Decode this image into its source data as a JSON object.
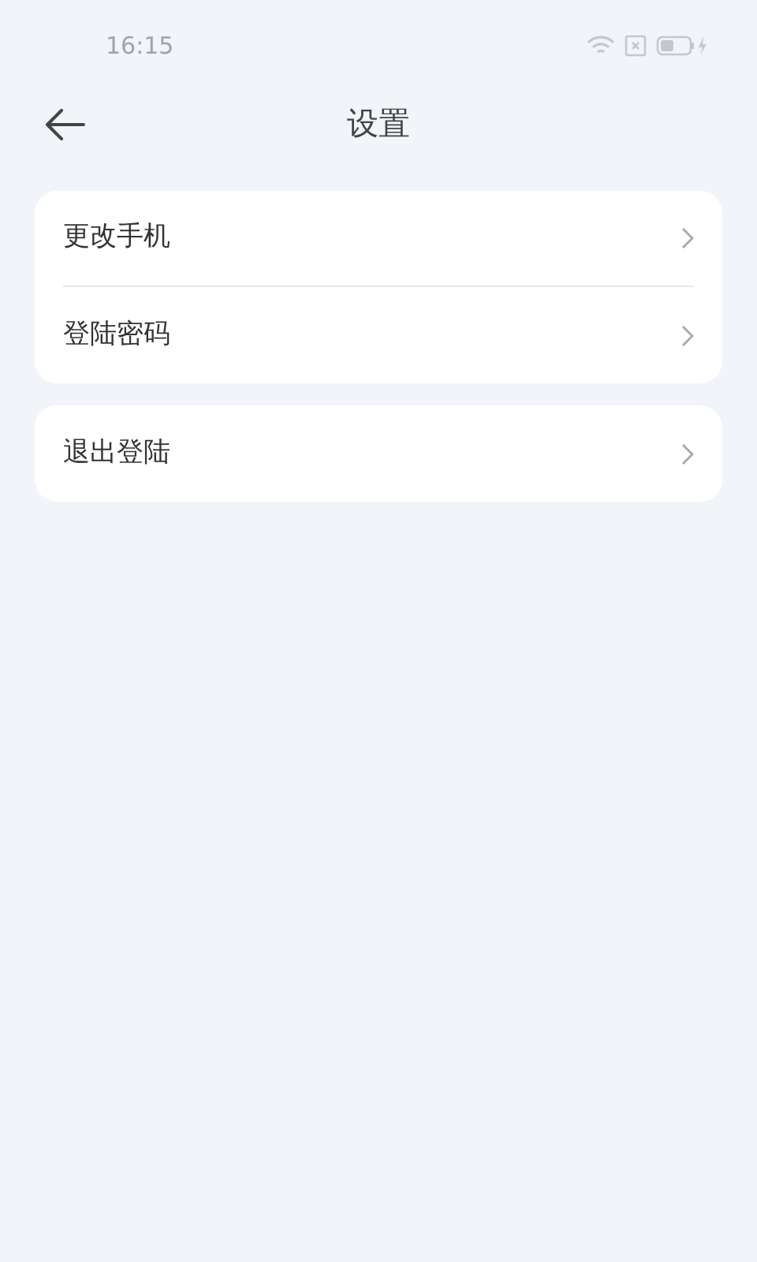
{
  "status_bar": {
    "time": "16:15"
  },
  "header": {
    "title": "设置"
  },
  "groups": [
    {
      "items": [
        {
          "label": "更改手机"
        },
        {
          "label": "登陆密码"
        }
      ]
    },
    {
      "items": [
        {
          "label": "退出登陆"
        }
      ]
    }
  ]
}
